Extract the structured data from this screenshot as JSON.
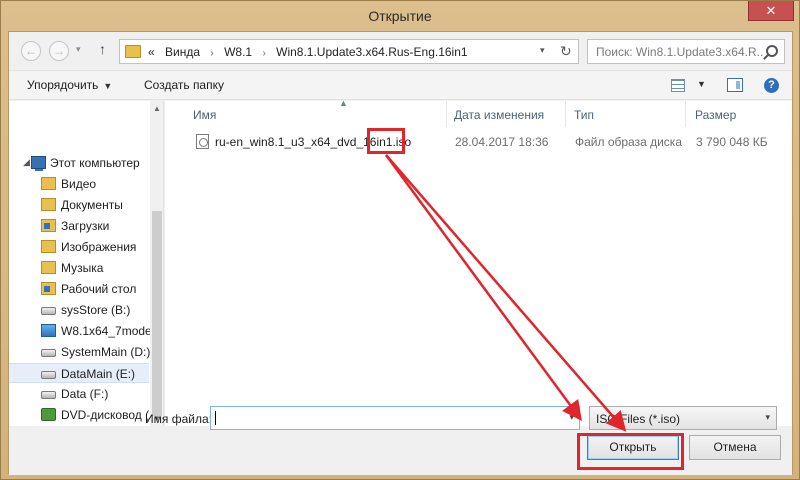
{
  "window": {
    "title": "Открытие",
    "close_glyph": "✕"
  },
  "nav": {
    "back_glyph": "←",
    "forward_glyph": "→",
    "up_glyph": "↑",
    "history_glyph": "▾"
  },
  "address": {
    "crumb_prefix": "«",
    "crumbs": [
      "Винда",
      "W8.1",
      "Win8.1.Update3.x64.Rus-Eng.16in1"
    ],
    "separator": "›",
    "dropdown_glyph": "▾",
    "refresh_glyph": "↻"
  },
  "search": {
    "placeholder": "Поиск: Win8.1.Update3.x64.R..."
  },
  "toolbar": {
    "organize_label": "Упорядочить",
    "organize_arrow": "▼",
    "new_folder_label": "Создать папку",
    "view_arrow": "▼",
    "help_glyph": "?"
  },
  "sidebar": {
    "items": [
      {
        "label": "Этот компьютер",
        "icon": "computer-icon",
        "expand": "◢"
      },
      {
        "label": "Видео",
        "icon": "folder-video-icon"
      },
      {
        "label": "Документы",
        "icon": "folder-documents-icon"
      },
      {
        "label": "Загрузки",
        "icon": "folder-downloads-icon"
      },
      {
        "label": "Изображения",
        "icon": "folder-pictures-icon"
      },
      {
        "label": "Музыка",
        "icon": "folder-music-icon"
      },
      {
        "label": "Рабочий стол",
        "icon": "folder-desktop-icon"
      },
      {
        "label": "sysStore (B:)",
        "icon": "drive-icon"
      },
      {
        "label": "W8.1x64_7mode",
        "icon": "network-drive-icon"
      },
      {
        "label": "SystemMain (D:)",
        "icon": "drive-icon"
      },
      {
        "label": "DataMain (E:)",
        "icon": "drive-icon",
        "selected": true
      },
      {
        "label": "Data (F:)",
        "icon": "drive-icon"
      },
      {
        "label": "DVD-дисковод (",
        "icon": "dvd-drive-icon"
      }
    ],
    "scroll_up": "▲",
    "scroll_down": "▼"
  },
  "columns": {
    "name": "Имя",
    "date": "Дата изменения",
    "type": "Тип",
    "size": "Размер",
    "sort_glyph": "▲"
  },
  "files": [
    {
      "name": "ru-en_win8.1_u3_x64_dvd_16in1.iso",
      "date": "28.04.2017 18:36",
      "type": "Файл образа диска",
      "size": "3 790 048 КБ"
    }
  ],
  "footer": {
    "filename_label": "Имя файла:",
    "filename_value": "",
    "filename_drop": "▾",
    "filetype_value": "ISO Files (*.iso)",
    "filetype_drop": "▾",
    "open_label": "Открыть",
    "cancel_label": "Отмена"
  },
  "annotation": {
    "color": "#e0262b"
  }
}
